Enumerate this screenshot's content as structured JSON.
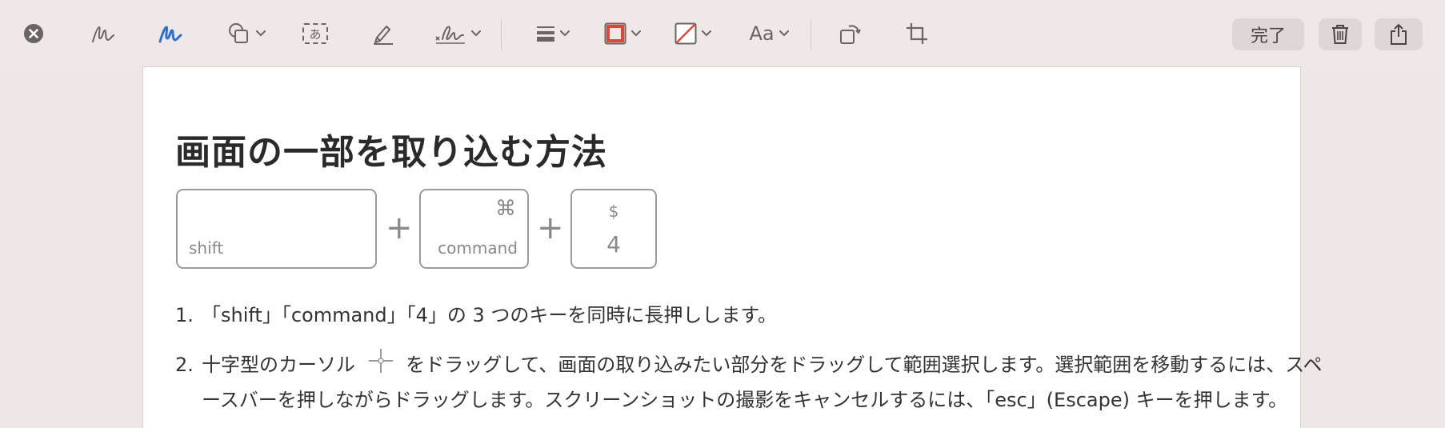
{
  "toolbar": {
    "tools": [
      {
        "icon": "close-circle-icon"
      },
      {
        "icon": "sketch-icon"
      },
      {
        "icon": "draw-icon",
        "active_color": "#2f6fd6"
      },
      {
        "icon": "shapes-icon"
      },
      {
        "icon": "text-box-icon",
        "glyph": "あ"
      },
      {
        "icon": "highlight-icon"
      },
      {
        "icon": "signature-icon"
      },
      {
        "icon": "line-style-icon"
      },
      {
        "icon": "border-color-icon",
        "color": "#e0443a"
      },
      {
        "icon": "fill-color-icon"
      },
      {
        "icon": "text-style-icon",
        "label": "Aa"
      },
      {
        "icon": "rotate-icon"
      },
      {
        "icon": "crop-icon"
      }
    ],
    "done_label": "完了",
    "trash_icon": "trash-icon",
    "share_icon": "share-icon"
  },
  "document": {
    "title": "画面の一部を取り込む方法",
    "keys": [
      {
        "label": "shift"
      },
      {
        "symbol": "⌘",
        "label": "command"
      },
      {
        "symbol": "$",
        "label": "4"
      }
    ],
    "plus": "+",
    "steps": [
      {
        "num": "1.",
        "text": "「shift」「command」「4」の 3 つのキーを同時に長押しします。"
      },
      {
        "num": "2.",
        "text_before": "十字型のカーソル",
        "text_after": "をドラッグして、画面の取り込みたい部分をドラッグして範囲選択します。選択範囲を移動するには、スペ",
        "text_line2": "ースバーを押しながらドラッグします。スクリーンショットの撮影をキャンセルするには、「esc」(Escape) キーを押します。"
      }
    ]
  }
}
